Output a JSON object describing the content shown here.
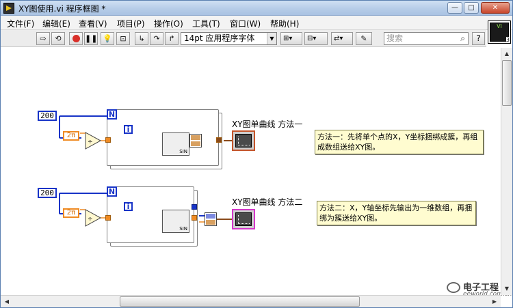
{
  "window": {
    "title": "XY图使用.vi 程序框图 *"
  },
  "menu": [
    "文件(F)",
    "编辑(E)",
    "查看(V)",
    "项目(P)",
    "操作(O)",
    "工具(T)",
    "窗口(W)",
    "帮助(H)"
  ],
  "toolbar": {
    "font": "14pt 应用程序字体",
    "search_placeholder": "搜索",
    "help": "?",
    "vi_icon_number": "3"
  },
  "diagram": {
    "const_200_a": "200",
    "const_200_b": "200",
    "two_pi_a": "2π",
    "two_pi_b": "2π",
    "n_a": "N",
    "n_b": "N",
    "i_a": "i",
    "i_b": "i",
    "sin_label": "SIN",
    "graph1_label": "XY图单曲线 方法一",
    "graph2_label": "XY图单曲线 方法二",
    "comment1": "方法一：先将单个点的X，Y坐标捆绑成簇，再组成数组送给XY图。",
    "comment2": "方法二：X，Y轴坐标先输出为一维数组，再捆绑为簇送给XY图。"
  },
  "watermark": {
    "text": "电子工程世界",
    "sub": "eeworld.com.cn"
  }
}
